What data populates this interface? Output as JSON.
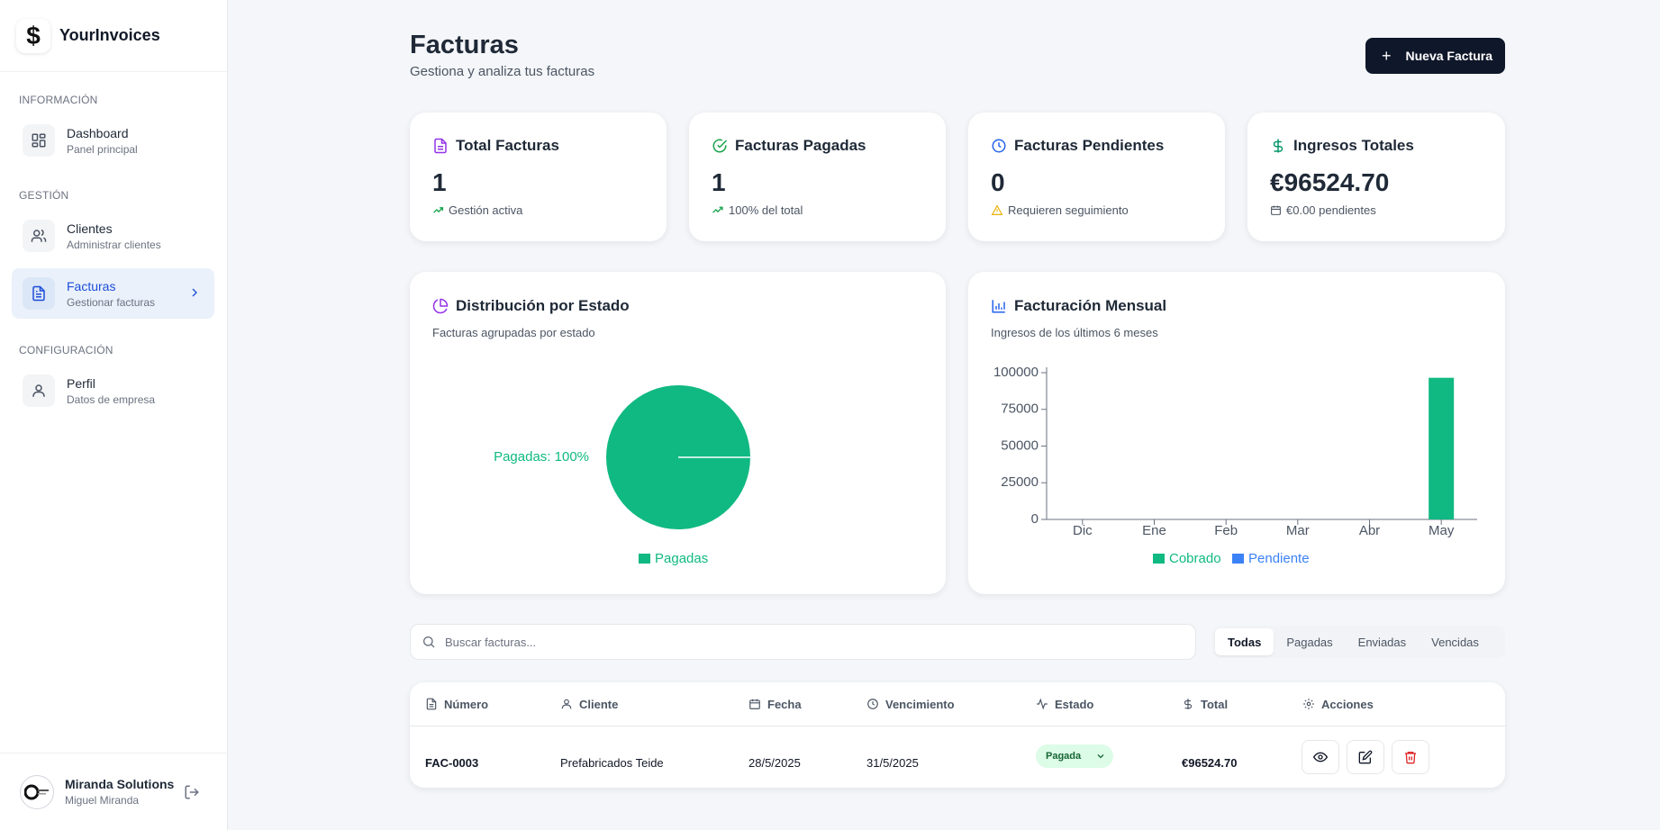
{
  "app": {
    "name": "YourInvoices",
    "logo_symbol": "$"
  },
  "sidebar": {
    "sections": [
      {
        "label": "INFORMACIÓN",
        "items": [
          {
            "title": "Dashboard",
            "subtitle": "Panel principal",
            "icon": "dashboard-icon"
          }
        ]
      },
      {
        "label": "GESTIÓN",
        "items": [
          {
            "title": "Clientes",
            "subtitle": "Administrar clientes",
            "icon": "users-icon"
          },
          {
            "title": "Facturas",
            "subtitle": "Gestionar facturas",
            "icon": "file-text-icon",
            "active": true
          }
        ]
      },
      {
        "label": "CONFIGURACIÓN",
        "items": [
          {
            "title": "Perfil",
            "subtitle": "Datos de empresa",
            "icon": "user-icon"
          }
        ]
      }
    ],
    "user": {
      "company": "Miranda Solutions",
      "name": "Miguel Miranda"
    }
  },
  "header": {
    "title": "Facturas",
    "subtitle": "Gestiona y analiza tus facturas",
    "new_button": "Nueva Factura"
  },
  "stats": [
    {
      "title": "Total Facturas",
      "value": "1",
      "note": "Gestión activa",
      "color": "#9333ea"
    },
    {
      "title": "Facturas Pagadas",
      "value": "1",
      "note": "100% del total",
      "color": "#16a34a"
    },
    {
      "title": "Facturas Pendientes",
      "value": "0",
      "note": "Requieren seguimiento",
      "color": "#2563eb"
    },
    {
      "title": "Ingresos Totales",
      "value": "€96524.70",
      "note": "€0.00 pendientes",
      "color": "#059669"
    }
  ],
  "distribution": {
    "title": "Distribución por Estado",
    "subtitle": "Facturas agrupadas por estado",
    "slice_label": "Pagadas: 100%",
    "legend": "Pagadas"
  },
  "monthly": {
    "title": "Facturación Mensual",
    "subtitle": "Ingresos de los últimos 6 meses",
    "legend": [
      "Cobrado",
      "Pendiente"
    ]
  },
  "chart_data": [
    {
      "type": "pie",
      "categories": [
        "Pagadas"
      ],
      "values": [
        100
      ],
      "labels": [
        "Pagadas: 100%"
      ],
      "colors": [
        "#10b981"
      ],
      "legend": "bottom"
    },
    {
      "type": "bar",
      "categories": [
        "Dic",
        "Ene",
        "Feb",
        "Mar",
        "Abr",
        "May"
      ],
      "series": [
        {
          "name": "Cobrado",
          "values": [
            0,
            0,
            0,
            0,
            0,
            96524.7
          ],
          "color": "#10b981"
        },
        {
          "name": "Pendiente",
          "values": [
            0,
            0,
            0,
            0,
            0,
            0
          ],
          "color": "#3b82f6"
        }
      ],
      "yticks": [
        0,
        25000,
        50000,
        75000,
        100000
      ],
      "ylim": [
        0,
        100000
      ],
      "grid": false,
      "legend": "bottom"
    }
  ],
  "search": {
    "placeholder": "Buscar facturas..."
  },
  "filters": [
    "Todas",
    "Pagadas",
    "Enviadas",
    "Vencidas"
  ],
  "table": {
    "headers": [
      "Número",
      "Cliente",
      "Fecha",
      "Vencimiento",
      "Estado",
      "Total",
      "Acciones"
    ],
    "rows": [
      {
        "numero": "FAC-0003",
        "cliente": "Prefabricados Teide",
        "fecha": "28/5/2025",
        "vencimiento": "31/5/2025",
        "estado": "Pagada",
        "total": "€96524.70"
      }
    ]
  }
}
